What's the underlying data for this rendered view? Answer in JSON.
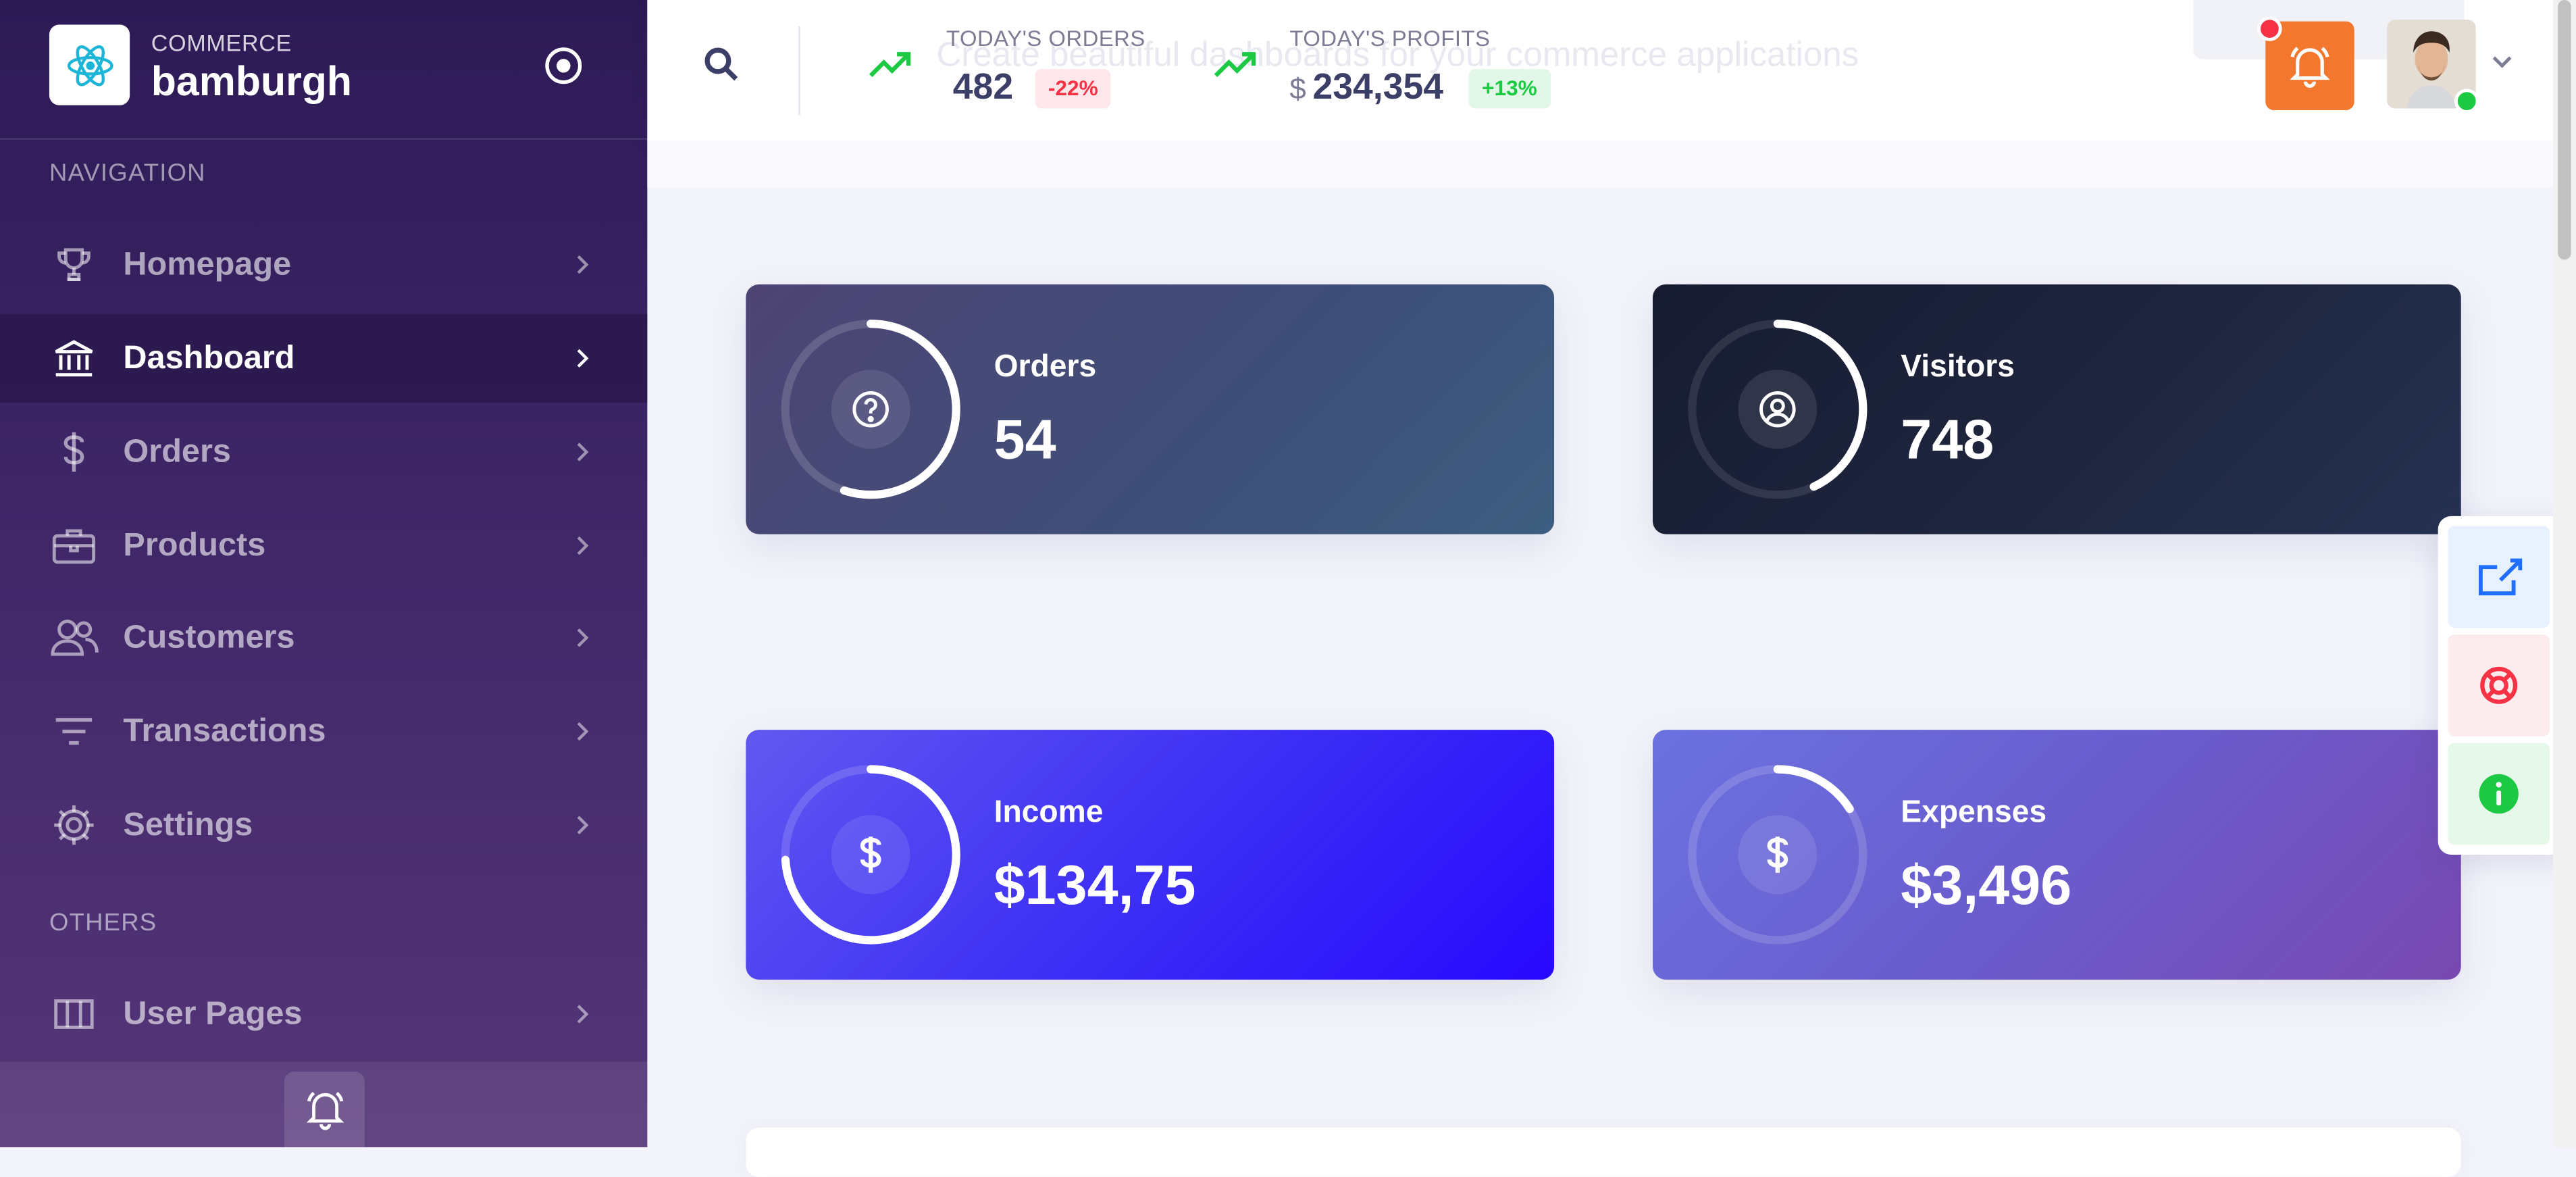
{
  "brand": {
    "subtitle": "COMMERCE",
    "name": "bamburgh"
  },
  "sidebar": {
    "navigation_heading": "NAVIGATION",
    "others_heading": "OTHERS",
    "items": [
      {
        "label": "Homepage",
        "icon": "trophy-icon"
      },
      {
        "label": "Dashboard",
        "icon": "bank-icon",
        "active": true
      },
      {
        "label": "Orders",
        "icon": "dollar-icon"
      },
      {
        "label": "Products",
        "icon": "briefcase-icon"
      },
      {
        "label": "Customers",
        "icon": "users-icon"
      },
      {
        "label": "Transactions",
        "icon": "filter-icon"
      },
      {
        "label": "Settings",
        "icon": "gear-icon"
      }
    ],
    "others_items": [
      {
        "label": "User Pages",
        "icon": "columns-icon"
      }
    ]
  },
  "header": {
    "background_text": "Create beautiful dashboards for your commerce applications",
    "stats": [
      {
        "label": "TODAY'S ORDERS",
        "value": "482",
        "change": "-22%",
        "trend": "negative"
      },
      {
        "label": "TODAY'S PROFITS",
        "currency": "$",
        "value": "234,354",
        "change": "+13%",
        "trend": "positive"
      }
    ]
  },
  "cards": [
    {
      "title": "Orders",
      "value": "54",
      "icon": "question-icon",
      "progress": 0.55
    },
    {
      "title": "Visitors",
      "value": "748",
      "icon": "user-circle-icon",
      "progress": 0.43
    },
    {
      "title": "Income",
      "value": "$134,75",
      "icon": "dollar-icon",
      "progress": 0.74
    },
    {
      "title": "Expenses",
      "value": "$3,496",
      "icon": "dollar-icon",
      "progress": 0.16
    }
  ],
  "float_panel": [
    {
      "icon": "share-icon",
      "color": "#1f6fff",
      "bg": "#e8f1ff"
    },
    {
      "icon": "lifebuoy-icon",
      "color": "#f83245",
      "bg": "#fdecee"
    },
    {
      "icon": "info-icon",
      "color": "#1bc943",
      "bg": "#e6f8ea"
    }
  ],
  "colors": {
    "accent_orange": "#f4772e",
    "danger": "#f83245",
    "success": "#1bc943",
    "sidebar_top": "#2c1a55",
    "sidebar_bottom": "#553679"
  }
}
